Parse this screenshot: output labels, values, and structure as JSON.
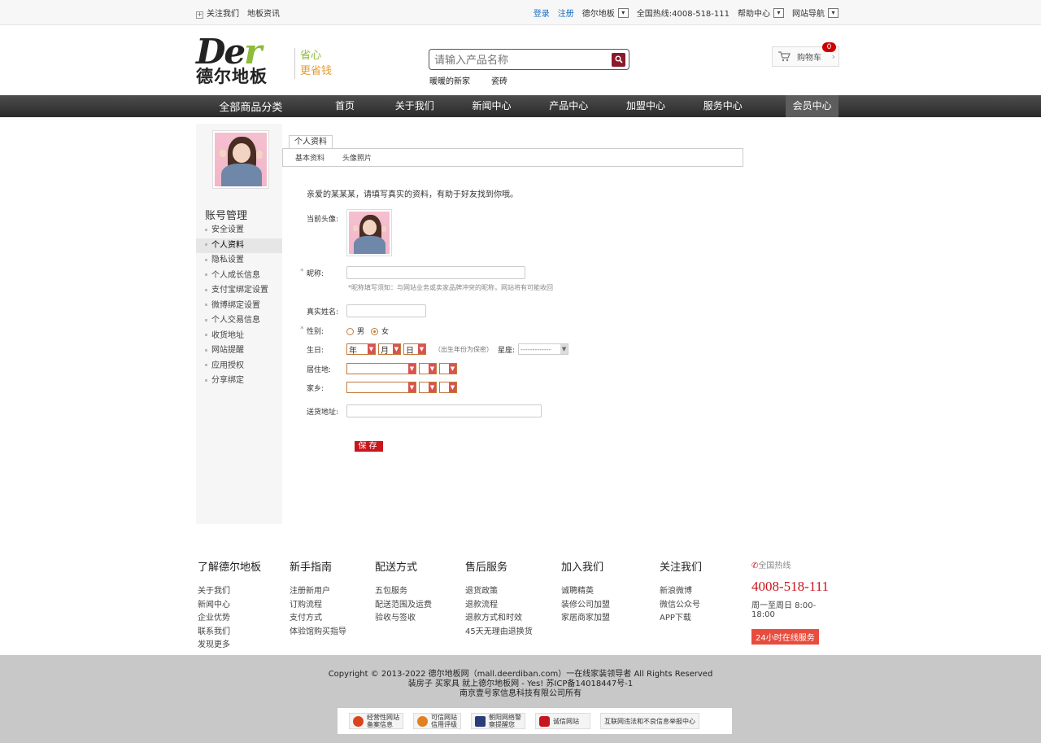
{
  "topbar": {
    "follow": "关注我们",
    "news": "地板资讯",
    "login": "登录",
    "register": "注册",
    "brand": "德尔地板",
    "hotline": "全国热线:4008-518-111",
    "help": "帮助中心",
    "sitenav": "网站导航"
  },
  "header": {
    "logo_latin": "Der",
    "logo_cn": "德尔地板",
    "slogan1": "省心",
    "slogan2": "更省钱",
    "search_placeholder": "请输入产品名称",
    "hot1": "暖暖的新家",
    "hot2": "瓷砖",
    "cart_label": "购物车",
    "cart_count": "0"
  },
  "nav": {
    "all": "全部商品分类",
    "items": [
      "首页",
      "关于我们",
      "新闻中心",
      "产品中心",
      "加盟中心",
      "服务中心",
      "会员中心"
    ]
  },
  "sidebar": {
    "title": "账号管理",
    "items": [
      "安全设置",
      "个人资料",
      "隐私设置",
      "个人成长信息",
      "支付宝绑定设置",
      "微博绑定设置",
      "个人交易信息",
      "收货地址",
      "网站提醒",
      "应用授权",
      "分享绑定"
    ]
  },
  "content": {
    "tab": "个人资料",
    "subtab1": "基本资料",
    "subtab2": "头像照片",
    "intro": "亲爱的某某某，请填写真实的资料，有助于好友找到你哦。",
    "avatar_label": "当前头像:",
    "nick_label": "昵称:",
    "nick_hint": "*昵称填写须知：与网站业务或卖家品牌冲突的昵称，网站将有可能收回",
    "realname_label": "真实姓名:",
    "gender_label": "性别:",
    "male": "男",
    "female": "女",
    "birthday_label": "生日:",
    "year": "年",
    "month": "月",
    "day": "日",
    "birthday_note": "（出生年份为保密）",
    "zodiac_label": "星座:",
    "zodiac_value": "-------------",
    "residence_label": "居住地:",
    "hometown_label": "家乡:",
    "address_label": "送货地址:",
    "save": "保存"
  },
  "footer": {
    "cols": [
      {
        "title": "了解德尔地板",
        "links": [
          "关于我们",
          "新闻中心",
          "企业优势",
          "联系我们",
          "发现更多"
        ]
      },
      {
        "title": "新手指南",
        "links": [
          "注册新用户",
          "订购流程",
          "支付方式",
          "体验馆购买指导"
        ]
      },
      {
        "title": "配送方式",
        "links": [
          "五包服务",
          "配送范围及运费",
          "验收与签收"
        ]
      },
      {
        "title": "售后服务",
        "links": [
          "退货政策",
          "退款流程",
          "退款方式和时效",
          "45天无理由退换货"
        ]
      },
      {
        "title": "加入我们",
        "links": [
          "诚聘精英",
          "装修公司加盟",
          "家居商家加盟"
        ]
      },
      {
        "title": "关注我们",
        "links": [
          "新浪微博",
          "微信公众号",
          "APP下载"
        ]
      }
    ],
    "hot_title": "全国热线",
    "hot_number": "4008-518-111",
    "hot_hours": "周一至周日 8:00-18:00",
    "online": "24小时在线服务",
    "copyright1": "Copyright © 2013-2022 德尔地板网（mall.deerdiban.com）一在线家装领导者 All Rights Reserved",
    "copyright2": "装房子 买家具 就上德尔地板网 - Yes! 苏ICP备14018447号-1",
    "copyright3": "南京壹号家信息科技有限公司所有",
    "badges": [
      [
        "经营性网站",
        "备案信息"
      ],
      [
        "可信网站",
        "信用评级"
      ],
      [
        "朝阳网络警",
        "察提醒您"
      ],
      [
        "诚信网站",
        ""
      ],
      [
        "互联网违法和不良信息举报中心",
        ""
      ]
    ]
  }
}
